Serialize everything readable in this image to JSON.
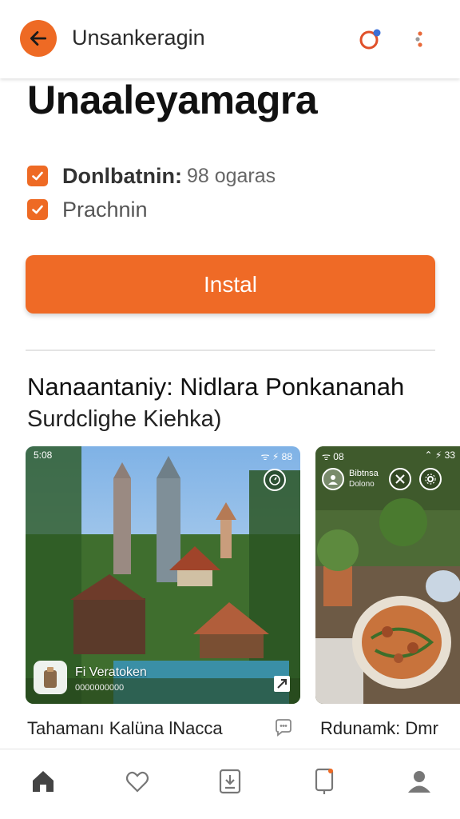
{
  "header": {
    "title": "Unsankeragin",
    "back_icon": "arrow-left-icon",
    "notify_icon": "notification-icon",
    "more_icon": "more-vertical-icon"
  },
  "app": {
    "title": "Unaaleyamagra",
    "features": [
      {
        "label": "Donlbatnin:",
        "value": "98 ogaras"
      },
      {
        "label": "Prachnin",
        "value": ""
      }
    ],
    "install_label": "Instal"
  },
  "section": {
    "title": "Nanaantaniy: Nidlara Ponkananah",
    "subtitle": "Surdclighe Kiehka)"
  },
  "cards": [
    {
      "status_left": "5:08",
      "status_right": "ᯤ ⚡ 88",
      "overlay_title": "Fi Veratoken",
      "overlay_sub": "0000000000",
      "title": "Tahamanı Kalüna lNacca"
    },
    {
      "status_left": "ᯤ 08",
      "status_right": "⌃ ⚡ 33",
      "profile_name": "Bibtnsa",
      "profile_sub": "Dolono",
      "title": "Rdunamk: Dmr"
    }
  ],
  "nav": {
    "items": [
      "home-icon",
      "heart-icon",
      "apps-icon",
      "device-icon",
      "profile-icon"
    ]
  },
  "colors": {
    "accent": "#ee6a24",
    "text": "#111111"
  }
}
